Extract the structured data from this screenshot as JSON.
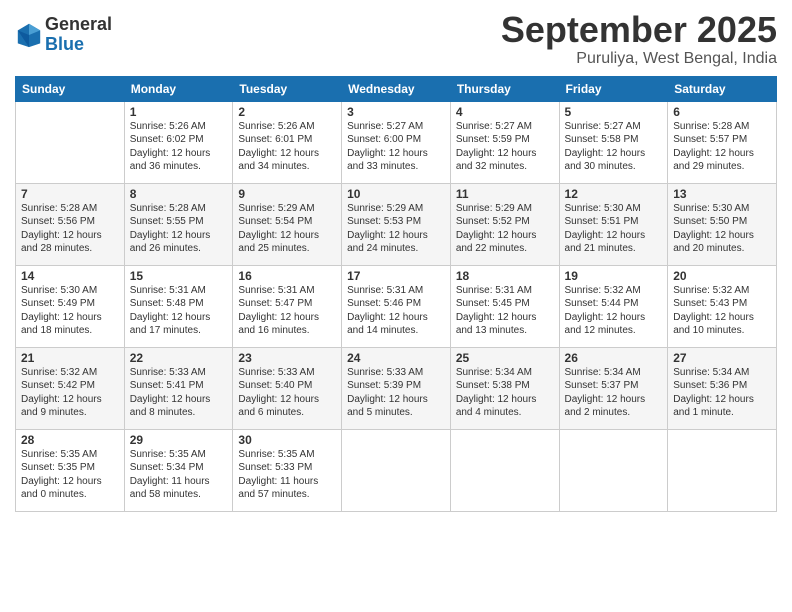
{
  "header": {
    "logo_general": "General",
    "logo_blue": "Blue",
    "month": "September 2025",
    "location": "Puruliya, West Bengal, India"
  },
  "weekdays": [
    "Sunday",
    "Monday",
    "Tuesday",
    "Wednesday",
    "Thursday",
    "Friday",
    "Saturday"
  ],
  "weeks": [
    [
      {
        "day": "",
        "info": ""
      },
      {
        "day": "1",
        "info": "Sunrise: 5:26 AM\nSunset: 6:02 PM\nDaylight: 12 hours\nand 36 minutes."
      },
      {
        "day": "2",
        "info": "Sunrise: 5:26 AM\nSunset: 6:01 PM\nDaylight: 12 hours\nand 34 minutes."
      },
      {
        "day": "3",
        "info": "Sunrise: 5:27 AM\nSunset: 6:00 PM\nDaylight: 12 hours\nand 33 minutes."
      },
      {
        "day": "4",
        "info": "Sunrise: 5:27 AM\nSunset: 5:59 PM\nDaylight: 12 hours\nand 32 minutes."
      },
      {
        "day": "5",
        "info": "Sunrise: 5:27 AM\nSunset: 5:58 PM\nDaylight: 12 hours\nand 30 minutes."
      },
      {
        "day": "6",
        "info": "Sunrise: 5:28 AM\nSunset: 5:57 PM\nDaylight: 12 hours\nand 29 minutes."
      }
    ],
    [
      {
        "day": "7",
        "info": "Sunrise: 5:28 AM\nSunset: 5:56 PM\nDaylight: 12 hours\nand 28 minutes."
      },
      {
        "day": "8",
        "info": "Sunrise: 5:28 AM\nSunset: 5:55 PM\nDaylight: 12 hours\nand 26 minutes."
      },
      {
        "day": "9",
        "info": "Sunrise: 5:29 AM\nSunset: 5:54 PM\nDaylight: 12 hours\nand 25 minutes."
      },
      {
        "day": "10",
        "info": "Sunrise: 5:29 AM\nSunset: 5:53 PM\nDaylight: 12 hours\nand 24 minutes."
      },
      {
        "day": "11",
        "info": "Sunrise: 5:29 AM\nSunset: 5:52 PM\nDaylight: 12 hours\nand 22 minutes."
      },
      {
        "day": "12",
        "info": "Sunrise: 5:30 AM\nSunset: 5:51 PM\nDaylight: 12 hours\nand 21 minutes."
      },
      {
        "day": "13",
        "info": "Sunrise: 5:30 AM\nSunset: 5:50 PM\nDaylight: 12 hours\nand 20 minutes."
      }
    ],
    [
      {
        "day": "14",
        "info": "Sunrise: 5:30 AM\nSunset: 5:49 PM\nDaylight: 12 hours\nand 18 minutes."
      },
      {
        "day": "15",
        "info": "Sunrise: 5:31 AM\nSunset: 5:48 PM\nDaylight: 12 hours\nand 17 minutes."
      },
      {
        "day": "16",
        "info": "Sunrise: 5:31 AM\nSunset: 5:47 PM\nDaylight: 12 hours\nand 16 minutes."
      },
      {
        "day": "17",
        "info": "Sunrise: 5:31 AM\nSunset: 5:46 PM\nDaylight: 12 hours\nand 14 minutes."
      },
      {
        "day": "18",
        "info": "Sunrise: 5:31 AM\nSunset: 5:45 PM\nDaylight: 12 hours\nand 13 minutes."
      },
      {
        "day": "19",
        "info": "Sunrise: 5:32 AM\nSunset: 5:44 PM\nDaylight: 12 hours\nand 12 minutes."
      },
      {
        "day": "20",
        "info": "Sunrise: 5:32 AM\nSunset: 5:43 PM\nDaylight: 12 hours\nand 10 minutes."
      }
    ],
    [
      {
        "day": "21",
        "info": "Sunrise: 5:32 AM\nSunset: 5:42 PM\nDaylight: 12 hours\nand 9 minutes."
      },
      {
        "day": "22",
        "info": "Sunrise: 5:33 AM\nSunset: 5:41 PM\nDaylight: 12 hours\nand 8 minutes."
      },
      {
        "day": "23",
        "info": "Sunrise: 5:33 AM\nSunset: 5:40 PM\nDaylight: 12 hours\nand 6 minutes."
      },
      {
        "day": "24",
        "info": "Sunrise: 5:33 AM\nSunset: 5:39 PM\nDaylight: 12 hours\nand 5 minutes."
      },
      {
        "day": "25",
        "info": "Sunrise: 5:34 AM\nSunset: 5:38 PM\nDaylight: 12 hours\nand 4 minutes."
      },
      {
        "day": "26",
        "info": "Sunrise: 5:34 AM\nSunset: 5:37 PM\nDaylight: 12 hours\nand 2 minutes."
      },
      {
        "day": "27",
        "info": "Sunrise: 5:34 AM\nSunset: 5:36 PM\nDaylight: 12 hours\nand 1 minute."
      }
    ],
    [
      {
        "day": "28",
        "info": "Sunrise: 5:35 AM\nSunset: 5:35 PM\nDaylight: 12 hours\nand 0 minutes."
      },
      {
        "day": "29",
        "info": "Sunrise: 5:35 AM\nSunset: 5:34 PM\nDaylight: 11 hours\nand 58 minutes."
      },
      {
        "day": "30",
        "info": "Sunrise: 5:35 AM\nSunset: 5:33 PM\nDaylight: 11 hours\nand 57 minutes."
      },
      {
        "day": "",
        "info": ""
      },
      {
        "day": "",
        "info": ""
      },
      {
        "day": "",
        "info": ""
      },
      {
        "day": "",
        "info": ""
      }
    ]
  ]
}
